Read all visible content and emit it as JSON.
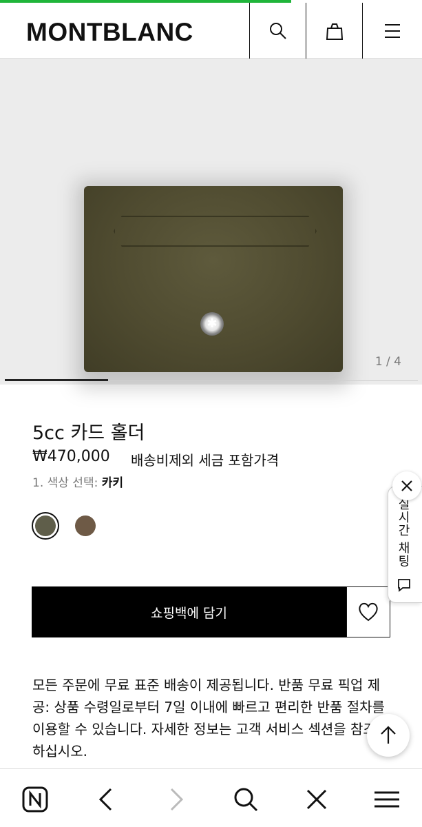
{
  "header": {
    "logo": "MONTBLANC",
    "icons": [
      "search-icon",
      "shopping-bag-icon",
      "hamburger-menu-icon"
    ]
  },
  "gallery": {
    "counter": "1 / 4",
    "current_index": 1,
    "total": 4
  },
  "product": {
    "title": "5cc 카드 홀더",
    "price": "₩470,000",
    "tax_note": "배송비제외 세금 포함가격",
    "color_label": "1. 색상 선택:",
    "color_value": "카키",
    "swatches": [
      {
        "name": "khaki",
        "color": "#5f5e4a",
        "selected": true
      },
      {
        "name": "brown",
        "color": "#6e5a46",
        "selected": false
      }
    ]
  },
  "actions": {
    "add_to_cart": "쇼핑백에 담기"
  },
  "chat": {
    "label": "실시간 채팅"
  },
  "description": "모든 주문에 무료 표준 배송이 제공됩니다. 반품 무료 픽업 제공: 상품 수령일로부터 7일 이내에 빠르고 편리한 반품 절차를 이용할 수 있습니다. 자세한 정보는 고객 서비스 섹션을 참조하십시오.",
  "bottom_nav": {
    "icons": [
      "naver-home-icon",
      "back-icon",
      "forward-icon",
      "search-icon",
      "close-icon",
      "menu-icon"
    ]
  },
  "colors": {
    "progress": "#1fb53a",
    "button_bg": "#000000"
  }
}
